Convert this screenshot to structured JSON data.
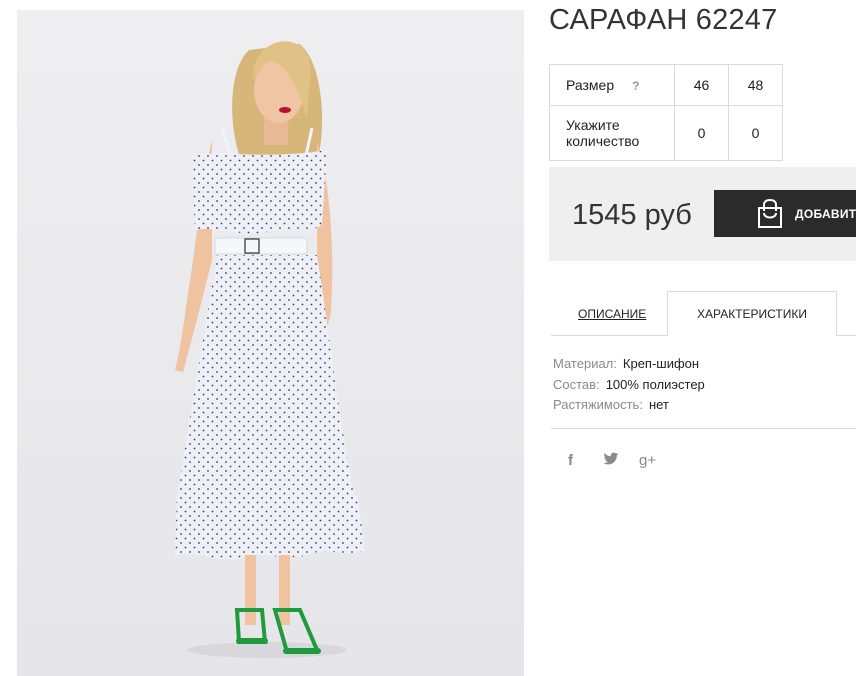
{
  "product": {
    "title": "САРАФАН 62247"
  },
  "size_table": {
    "size_label": "Размер",
    "help_glyph": "?",
    "sizes": [
      "46",
      "48"
    ],
    "qty_label": "Укажите количество",
    "quantities": [
      "0",
      "0"
    ]
  },
  "purchase": {
    "price": "1545 руб",
    "add_button_label": "ДОБАВИТЬ В КОРЗИНУ",
    "add_button_icon": "shopping-bag-icon"
  },
  "tabs": [
    {
      "label": "ОПИСАНИЕ",
      "active": false
    },
    {
      "label": "ХАРАКТЕРИСТИКИ",
      "active": true
    }
  ],
  "specs": [
    {
      "key": "Материал:",
      "value": "Креп-шифон"
    },
    {
      "key": "Состав:",
      "value": "100% полиэстер"
    },
    {
      "key": "Растяжимость:",
      "value": "нет"
    }
  ],
  "social": [
    {
      "icon": "facebook-icon",
      "glyph": "f"
    },
    {
      "icon": "twitter-icon",
      "glyph": "t"
    },
    {
      "icon": "google-plus-icon",
      "glyph": "g+"
    }
  ],
  "colors": {
    "button_bg": "#2b2b2b",
    "price_box_bg": "#efefef",
    "photo_bg": "#ededf0",
    "muted_text": "#8a8a8a"
  }
}
